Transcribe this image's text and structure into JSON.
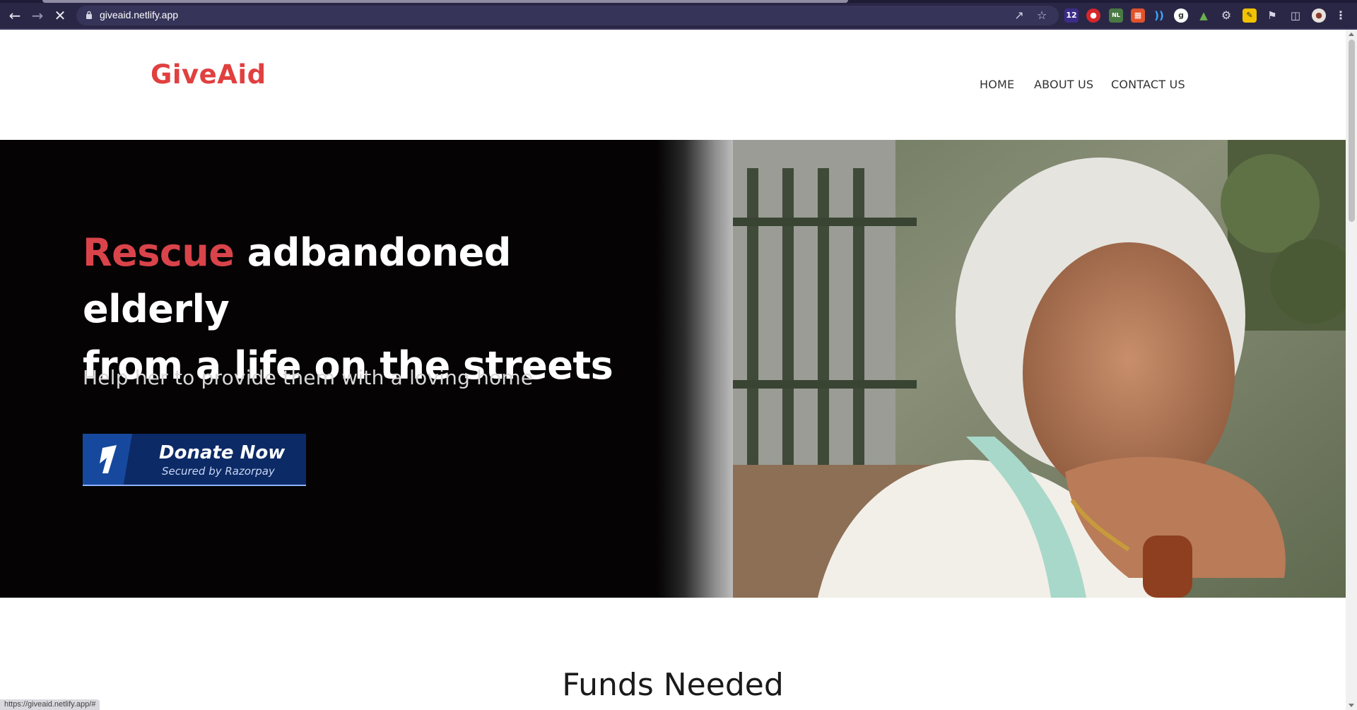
{
  "browser": {
    "url": "giveaid.netlify.app",
    "status_url": "https://giveaid.netlify.app/#",
    "icons": [
      "back-arrow-icon",
      "forward-arrow-icon",
      "stop-loading-icon",
      "lock-icon",
      "share-icon",
      "bookmark-star-icon",
      "extensions-icon",
      "side-panel-icon",
      "profile-avatar",
      "more-menu-icon"
    ],
    "extension_badges": {
      "first": "12",
      "nl": "NL"
    }
  },
  "site": {
    "logo": "GiveAid",
    "brand_color": "#e0403f",
    "nav": [
      {
        "label": "HOME"
      },
      {
        "label": "ABOUT US"
      },
      {
        "label": "CONTACT US"
      }
    ]
  },
  "hero": {
    "headline_accent": "Rescue",
    "headline_rest_line1": "adbandoned elderly",
    "headline_line2": "from a life on the streets",
    "subline": "Help her to provide them with a loving home",
    "accent_color": "#d9434a",
    "donate_button": {
      "title": "Donate Now",
      "subtitle": "Secured by Razorpay",
      "color": "#0c2a66"
    }
  },
  "sections": {
    "funds_title": "Funds Needed"
  }
}
